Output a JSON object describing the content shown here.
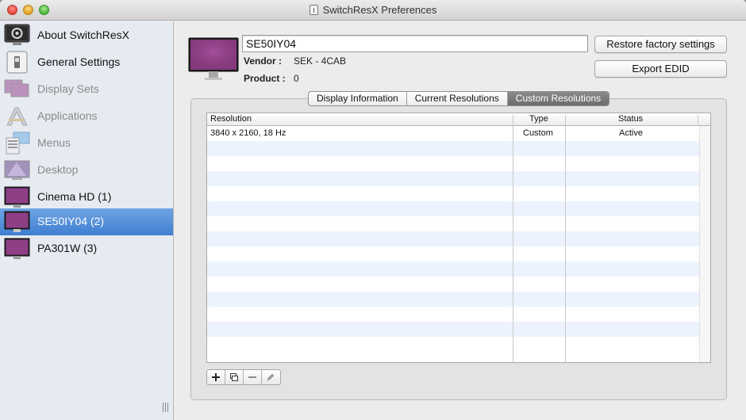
{
  "window": {
    "title": "SwitchResX Preferences"
  },
  "sidebar": {
    "items": [
      {
        "label": "About SwitchResX",
        "icon": "switchresx-app-icon",
        "state": "normal"
      },
      {
        "label": "General Settings",
        "icon": "switch-icon",
        "state": "normal"
      },
      {
        "label": "Display Sets",
        "icon": "display-sets-icon",
        "state": "disabled"
      },
      {
        "label": "Applications",
        "icon": "applications-icon",
        "state": "disabled"
      },
      {
        "label": "Menus",
        "icon": "menus-icon",
        "state": "disabled"
      },
      {
        "label": "Desktop",
        "icon": "desktop-icon",
        "state": "disabled"
      },
      {
        "label": "Cinema HD (1)",
        "icon": "monitor-icon",
        "state": "normal"
      },
      {
        "label": "SE50IY04 (2)",
        "icon": "monitor-icon",
        "state": "selected"
      },
      {
        "label": "PA301W (3)",
        "icon": "monitor-icon",
        "state": "normal"
      }
    ]
  },
  "display": {
    "name": "SE50IY04",
    "vendor_label": "Vendor :",
    "vendor_value": "SEK - 4CAB",
    "product_label": "Product :",
    "product_value": "0"
  },
  "buttons": {
    "restore": "Restore factory settings",
    "export": "Export EDID"
  },
  "tabs": [
    {
      "label": "Display Information",
      "active": false
    },
    {
      "label": "Current Resolutions",
      "active": false
    },
    {
      "label": "Custom Resolutions",
      "active": true
    }
  ],
  "table": {
    "columns": [
      "Resolution",
      "Type",
      "Status"
    ],
    "rows": [
      {
        "resolution": "3840 x 2160, 18 Hz",
        "type": "Custom",
        "status": "Active"
      }
    ]
  },
  "toolbar": {
    "add": "add-icon",
    "duplicate": "duplicate-icon",
    "remove": "minus-icon",
    "edit": "pencil-icon"
  },
  "colors": {
    "selection": "#4a88d8",
    "screen_purple": "#8e3f86",
    "row_alt": "#edf3fe"
  }
}
